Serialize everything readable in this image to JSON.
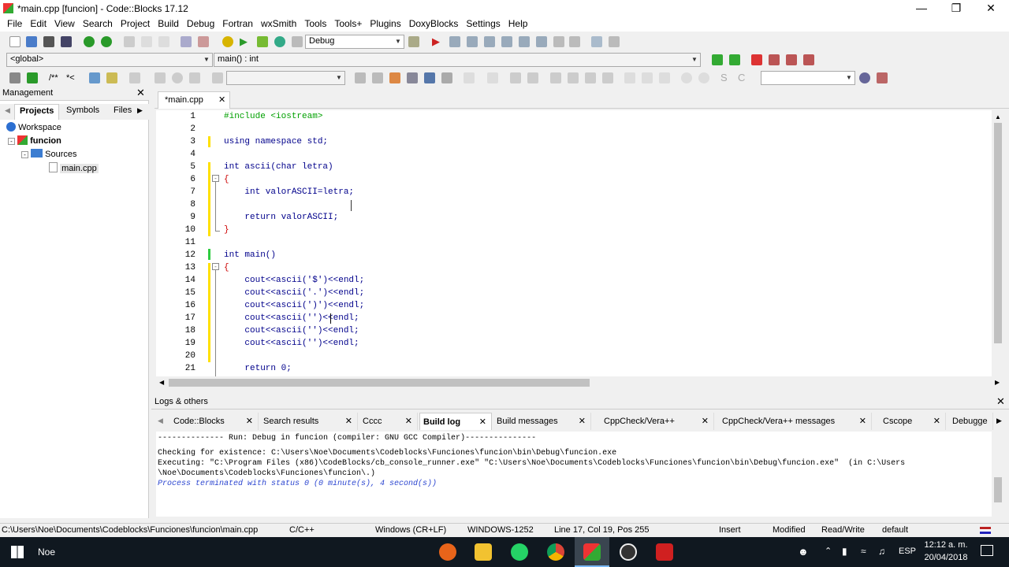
{
  "window": {
    "title": "*main.cpp [funcion] - Code::Blocks 17.12"
  },
  "menu": [
    "File",
    "Edit",
    "View",
    "Search",
    "Project",
    "Build",
    "Debug",
    "Fortran",
    "wxSmith",
    "Tools",
    "Tools+",
    "Plugins",
    "DoxyBlocks",
    "Settings",
    "Help"
  ],
  "toolbar": {
    "build_target": "Debug",
    "scope": "<global>",
    "function": "main() : int"
  },
  "management": {
    "title": "Management",
    "tabs": [
      "Projects",
      "Symbols",
      "Files"
    ],
    "tree": {
      "workspace": "Workspace",
      "project": "funcion",
      "folder": "Sources",
      "file": "main.cpp"
    }
  },
  "editor": {
    "tab_label": "*main.cpp",
    "lines": [
      {
        "n": "1",
        "text": "#include <iostream>"
      },
      {
        "n": "2",
        "text": ""
      },
      {
        "n": "3",
        "text": "using namespace std;"
      },
      {
        "n": "4",
        "text": ""
      },
      {
        "n": "5",
        "text": "int ascii(char letra)"
      },
      {
        "n": "6",
        "text": "{"
      },
      {
        "n": "7",
        "text": "    int valorASCII=letra;"
      },
      {
        "n": "8",
        "text": ""
      },
      {
        "n": "9",
        "text": "    return valorASCII;"
      },
      {
        "n": "10",
        "text": "}"
      },
      {
        "n": "11",
        "text": ""
      },
      {
        "n": "12",
        "text": "int main()"
      },
      {
        "n": "13",
        "text": "{"
      },
      {
        "n": "14",
        "text": "    cout<<ascii('$')<<endl;"
      },
      {
        "n": "15",
        "text": "    cout<<ascii('.')<<endl;"
      },
      {
        "n": "16",
        "text": "    cout<<ascii(')')<<endl;"
      },
      {
        "n": "17",
        "text": "    cout<<ascii('')<<endl;"
      },
      {
        "n": "18",
        "text": "    cout<<ascii('')<<endl;"
      },
      {
        "n": "19",
        "text": "    cout<<ascii('')<<endl;"
      },
      {
        "n": "20",
        "text": ""
      },
      {
        "n": "21",
        "text": "    return 0;"
      }
    ]
  },
  "logs": {
    "title": "Logs & others",
    "tabs": [
      "Code::Blocks",
      "Search results",
      "Cccc",
      "Build log",
      "Build messages",
      "CppCheck/Vera++",
      "CppCheck/Vera++ messages",
      "Cscope",
      "Debugge"
    ],
    "active_tab": "Build log",
    "lines": [
      "-------------- Run: Debug in funcion (compiler: GNU GCC Compiler)---------------",
      "",
      "Checking for existence: C:\\Users\\Noe\\Documents\\Codeblocks\\Funciones\\funcion\\bin\\Debug\\funcion.exe",
      "Executing: \"C:\\Program Files (x86)\\CodeBlocks/cb_console_runner.exe\" \"C:\\Users\\Noe\\Documents\\Codeblocks\\Funciones\\funcion\\bin\\Debug\\funcion.exe\"  (in C:\\Users",
      "\\Noe\\Documents\\Codeblocks\\Funciones\\funcion\\.)",
      "Process terminated with status 0 (0 minute(s), 4 second(s))"
    ]
  },
  "status": {
    "path": "C:\\Users\\Noe\\Documents\\Codeblocks\\Funciones\\funcion\\main.cpp",
    "lang": "C/C++",
    "eol": "Windows (CR+LF)",
    "encoding": "WINDOWS-1252",
    "position": "Line 17, Col 19, Pos 255",
    "mode": "Insert",
    "modified": "Modified",
    "rw": "Read/Write",
    "profile": "default"
  },
  "taskbar": {
    "user": "Noe",
    "lang": "ESP",
    "time": "12:12 a. m.",
    "date": "20/04/2018"
  }
}
